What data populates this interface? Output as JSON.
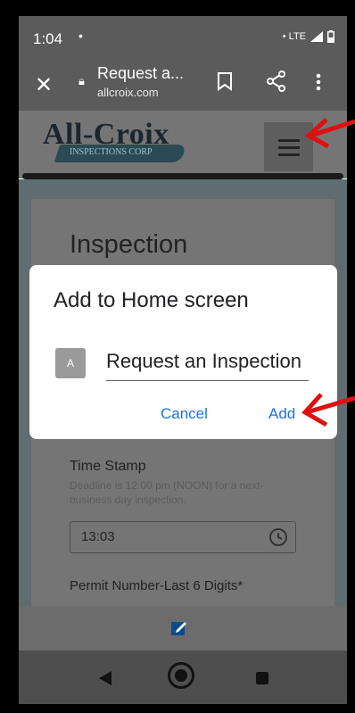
{
  "status_bar": {
    "time": "1:04",
    "notification_dot": "•",
    "network": "• LTE"
  },
  "browser": {
    "page_title": "Request a...",
    "domain": "allcroix.com",
    "icons": [
      "close-icon",
      "lock-icon",
      "bookmark-icon",
      "share-icon",
      "more-vert-icon"
    ]
  },
  "site": {
    "logo_text": "All-Croix",
    "logo_subtitle": "INSPECTIONS CORP"
  },
  "page": {
    "heading": "Inspection",
    "time_stamp_label": "Time Stamp",
    "deadline_note": "Deadline  is 12:00 pm (NOON) for a next-business day inspection.",
    "time_value": "13:03",
    "permit_label": "Permit Number-Last 6 Digits*"
  },
  "dialog": {
    "title": "Add to Home screen",
    "avatar_letter": "A",
    "name_value": "Request an Inspection",
    "cancel_label": "Cancel",
    "add_label": "Add"
  },
  "colors": {
    "accent": "#1a73e8",
    "annotation_arrow": "#e11010"
  }
}
